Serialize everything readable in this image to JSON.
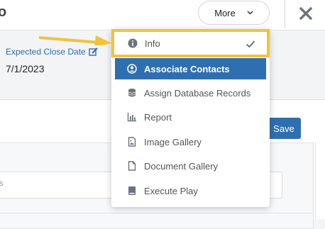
{
  "toolbar": {
    "more_label": "More"
  },
  "record": {
    "expected_close_label": "Expected Close Date",
    "expected_close_value": "7/1/2023"
  },
  "actions": {
    "save_label": "Save"
  },
  "menu": {
    "items": [
      {
        "label": "Info",
        "icon": "info-circle-icon",
        "checked": true
      },
      {
        "label": "Associate Contacts",
        "icon": "user-circle-icon"
      },
      {
        "label": "Assign Database Records",
        "icon": "database-icon"
      },
      {
        "label": "Report",
        "icon": "bar-chart-icon"
      },
      {
        "label": "Image Gallery",
        "icon": "image-file-icon"
      },
      {
        "label": "Document Gallery",
        "icon": "document-icon"
      },
      {
        "label": "Execute Play",
        "icon": "book-icon"
      }
    ]
  },
  "field": {
    "stub_text": "s"
  },
  "colors": {
    "accent": "#2f6fb0",
    "highlight": "#f0c33c",
    "link": "#2b6cb0"
  }
}
